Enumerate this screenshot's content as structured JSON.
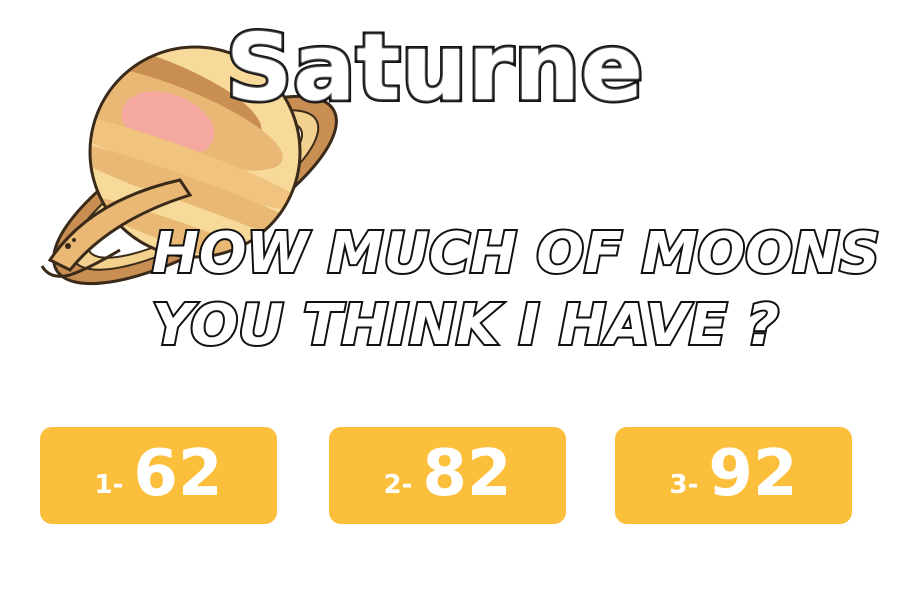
{
  "title": "Saturne",
  "question": {
    "line1": "HOW MUCH OF MOONS",
    "line2": "YOU THINK I HAVE ?"
  },
  "answers": [
    {
      "index": "1-",
      "value": "62"
    },
    {
      "index": "2-",
      "value": "82"
    },
    {
      "index": "3-",
      "value": "92"
    }
  ],
  "colors": {
    "answer_bg": "#fbbf3b",
    "answer_text": "#ffffff",
    "title_fill": "#ffffff",
    "outline": "#111111",
    "planet_light": "#f7d999",
    "planet_mid": "#e8b874",
    "planet_dark": "#c98f52",
    "planet_pink": "#f4a8a0"
  }
}
